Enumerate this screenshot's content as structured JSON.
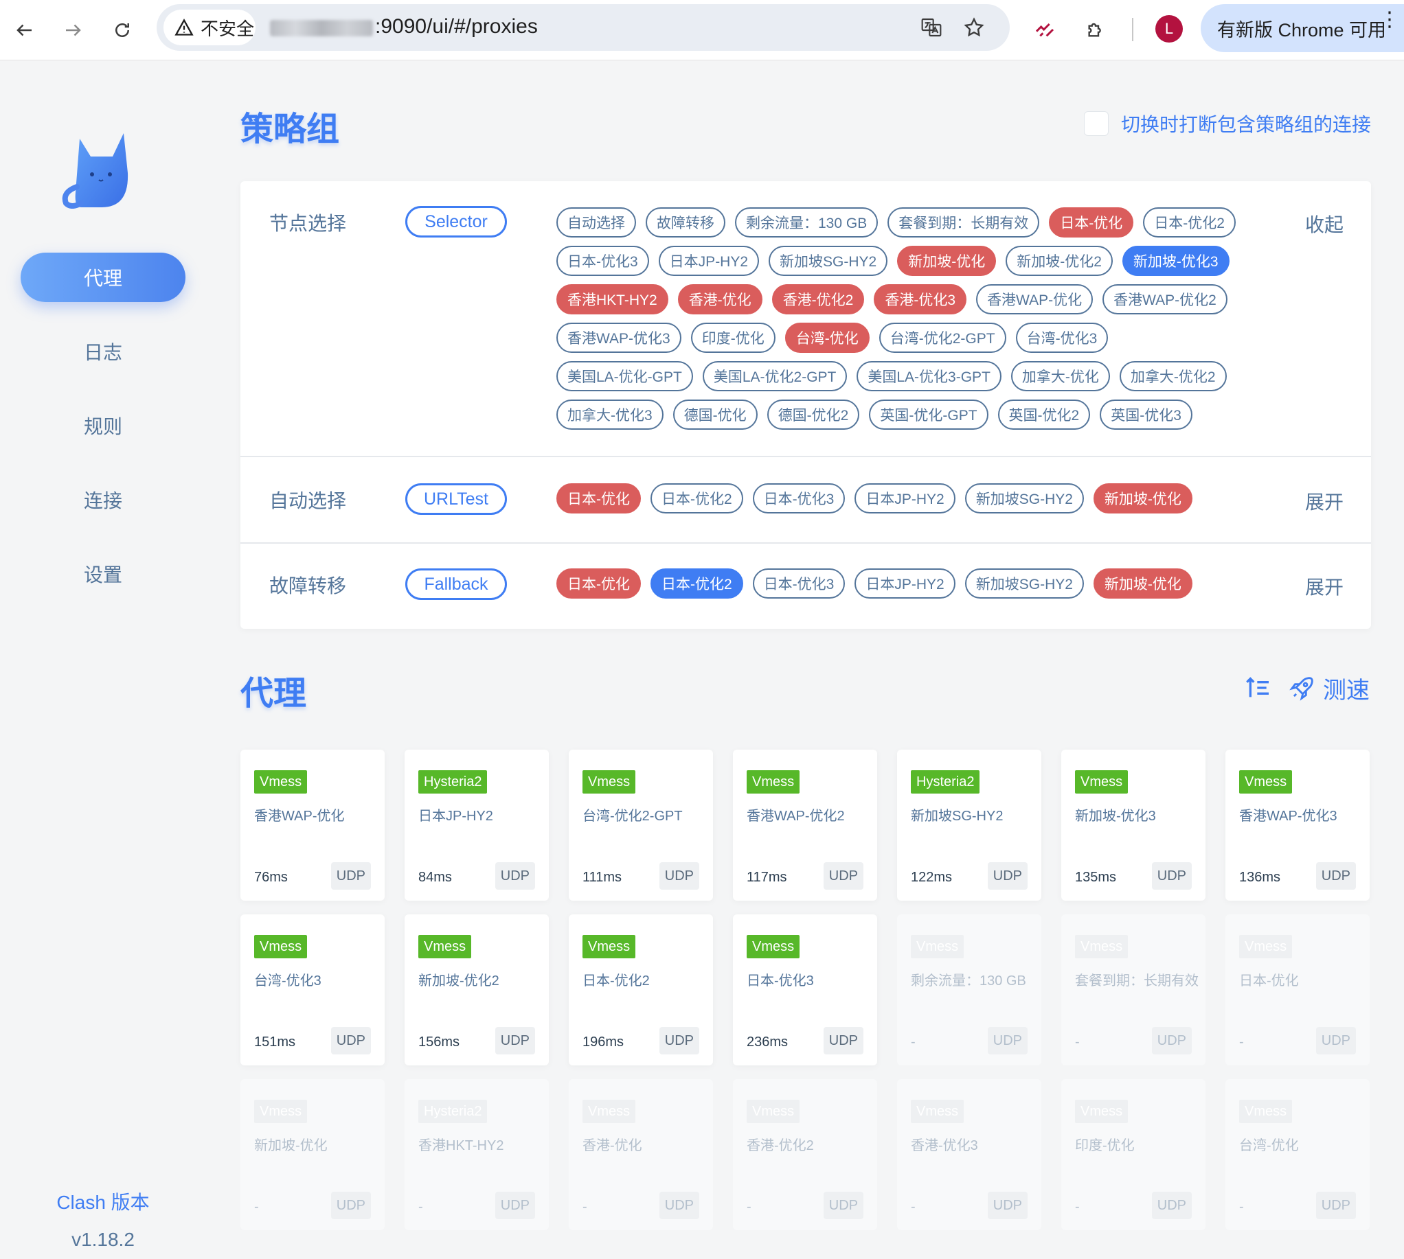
{
  "browser": {
    "security_label": "不安全",
    "url_suffix": ":9090/ui/#/proxies",
    "avatar_letter": "L",
    "update_label": "有新版 Chrome 可用"
  },
  "sidebar": {
    "items": [
      {
        "label": "代理",
        "active": true
      },
      {
        "label": "日志"
      },
      {
        "label": "规则"
      },
      {
        "label": "连接"
      },
      {
        "label": "设置"
      }
    ],
    "version_label": "Clash 版本",
    "version": "v1.18.2"
  },
  "groups_section": {
    "title": "策略组",
    "checkbox_label": "切换时打断包含策略组的连接",
    "groups": [
      {
        "name": "节点选择",
        "type": "Selector",
        "toggle": "收起",
        "proxies": [
          {
            "label": "自动选择"
          },
          {
            "label": "故障转移"
          },
          {
            "label": "剩余流量：130 GB"
          },
          {
            "label": "套餐到期：长期有效"
          },
          {
            "label": "日本-优化",
            "state": "red"
          },
          {
            "label": "日本-优化2"
          },
          {
            "label": "日本-优化3"
          },
          {
            "label": "日本JP-HY2"
          },
          {
            "label": "新加坡SG-HY2"
          },
          {
            "label": "新加坡-优化",
            "state": "red"
          },
          {
            "label": "新加坡-优化2"
          },
          {
            "label": "新加坡-优化3",
            "state": "blue"
          },
          {
            "label": "香港HKT-HY2",
            "state": "red"
          },
          {
            "label": "香港-优化",
            "state": "red"
          },
          {
            "label": "香港-优化2",
            "state": "red"
          },
          {
            "label": "香港-优化3",
            "state": "red"
          },
          {
            "label": "香港WAP-优化"
          },
          {
            "label": "香港WAP-优化2"
          },
          {
            "label": "香港WAP-优化3"
          },
          {
            "label": "印度-优化"
          },
          {
            "label": "台湾-优化",
            "state": "red"
          },
          {
            "label": "台湾-优化2-GPT"
          },
          {
            "label": "台湾-优化3"
          },
          {
            "label": "美国LA-优化-GPT"
          },
          {
            "label": "美国LA-优化2-GPT"
          },
          {
            "label": "美国LA-优化3-GPT"
          },
          {
            "label": "加拿大-优化"
          },
          {
            "label": "加拿大-优化2"
          },
          {
            "label": "加拿大-优化3"
          },
          {
            "label": "德国-优化"
          },
          {
            "label": "德国-优化2"
          },
          {
            "label": "英国-优化-GPT"
          },
          {
            "label": "英国-优化2"
          },
          {
            "label": "英国-优化3"
          }
        ]
      },
      {
        "name": "自动选择",
        "type": "URLTest",
        "toggle": "展开",
        "proxies": [
          {
            "label": "日本-优化",
            "state": "red"
          },
          {
            "label": "日本-优化2"
          },
          {
            "label": "日本-优化3"
          },
          {
            "label": "日本JP-HY2"
          },
          {
            "label": "新加坡SG-HY2"
          },
          {
            "label": "新加坡-优化",
            "state": "red"
          }
        ]
      },
      {
        "name": "故障转移",
        "type": "Fallback",
        "toggle": "展开",
        "proxies": [
          {
            "label": "日本-优化",
            "state": "red"
          },
          {
            "label": "日本-优化2",
            "state": "blue"
          },
          {
            "label": "日本-优化3"
          },
          {
            "label": "日本JP-HY2"
          },
          {
            "label": "新加坡SG-HY2"
          },
          {
            "label": "新加坡-优化",
            "state": "red"
          }
        ]
      }
    ]
  },
  "proxies_section": {
    "title": "代理",
    "speed_test_label": "测速",
    "cards": [
      {
        "type": "Vmess",
        "name": "香港WAP-优化",
        "delay": "76ms",
        "udp": "UDP",
        "dim": false
      },
      {
        "type": "Hysteria2",
        "name": "日本JP-HY2",
        "delay": "84ms",
        "udp": "UDP",
        "dim": false
      },
      {
        "type": "Vmess",
        "name": "台湾-优化2-GPT",
        "delay": "111ms",
        "udp": "UDP",
        "dim": false
      },
      {
        "type": "Vmess",
        "name": "香港WAP-优化2",
        "delay": "117ms",
        "udp": "UDP",
        "dim": false
      },
      {
        "type": "Hysteria2",
        "name": "新加坡SG-HY2",
        "delay": "122ms",
        "udp": "UDP",
        "dim": false
      },
      {
        "type": "Vmess",
        "name": "新加坡-优化3",
        "delay": "135ms",
        "udp": "UDP",
        "dim": false
      },
      {
        "type": "Vmess",
        "name": "香港WAP-优化3",
        "delay": "136ms",
        "udp": "UDP",
        "dim": false
      },
      {
        "type": "Vmess",
        "name": "台湾-优化3",
        "delay": "151ms",
        "udp": "UDP",
        "dim": false
      },
      {
        "type": "Vmess",
        "name": "新加坡-优化2",
        "delay": "156ms",
        "udp": "UDP",
        "dim": false
      },
      {
        "type": "Vmess",
        "name": "日本-优化2",
        "delay": "196ms",
        "udp": "UDP",
        "dim": false
      },
      {
        "type": "Vmess",
        "name": "日本-优化3",
        "delay": "236ms",
        "udp": "UDP",
        "dim": false
      },
      {
        "type": "Vmess",
        "name": "剩余流量：130 GB",
        "delay": "-",
        "udp": "UDP",
        "dim": true
      },
      {
        "type": "Vmess",
        "name": "套餐到期：长期有效",
        "delay": "-",
        "udp": "UDP",
        "dim": true
      },
      {
        "type": "Vmess",
        "name": "日本-优化",
        "delay": "-",
        "udp": "UDP",
        "dim": true
      },
      {
        "type": "Vmess",
        "name": "新加坡-优化",
        "delay": "-",
        "udp": "UDP",
        "dim": true
      },
      {
        "type": "Hysteria2",
        "name": "香港HKT-HY2",
        "delay": "-",
        "udp": "UDP",
        "dim": true
      },
      {
        "type": "Vmess",
        "name": "香港-优化",
        "delay": "-",
        "udp": "UDP",
        "dim": true
      },
      {
        "type": "Vmess",
        "name": "香港-优化2",
        "delay": "-",
        "udp": "UDP",
        "dim": true
      },
      {
        "type": "Vmess",
        "name": "香港-优化3",
        "delay": "-",
        "udp": "UDP",
        "dim": true
      },
      {
        "type": "Vmess",
        "name": "印度-优化",
        "delay": "-",
        "udp": "UDP",
        "dim": true
      },
      {
        "type": "Vmess",
        "name": "台湾-优化",
        "delay": "-",
        "udp": "UDP",
        "dim": true
      }
    ]
  },
  "colors": {
    "accent": "#3f7df3",
    "red_tag": "#da5d5c",
    "green_type": "#57b829",
    "text": "#54759a"
  }
}
